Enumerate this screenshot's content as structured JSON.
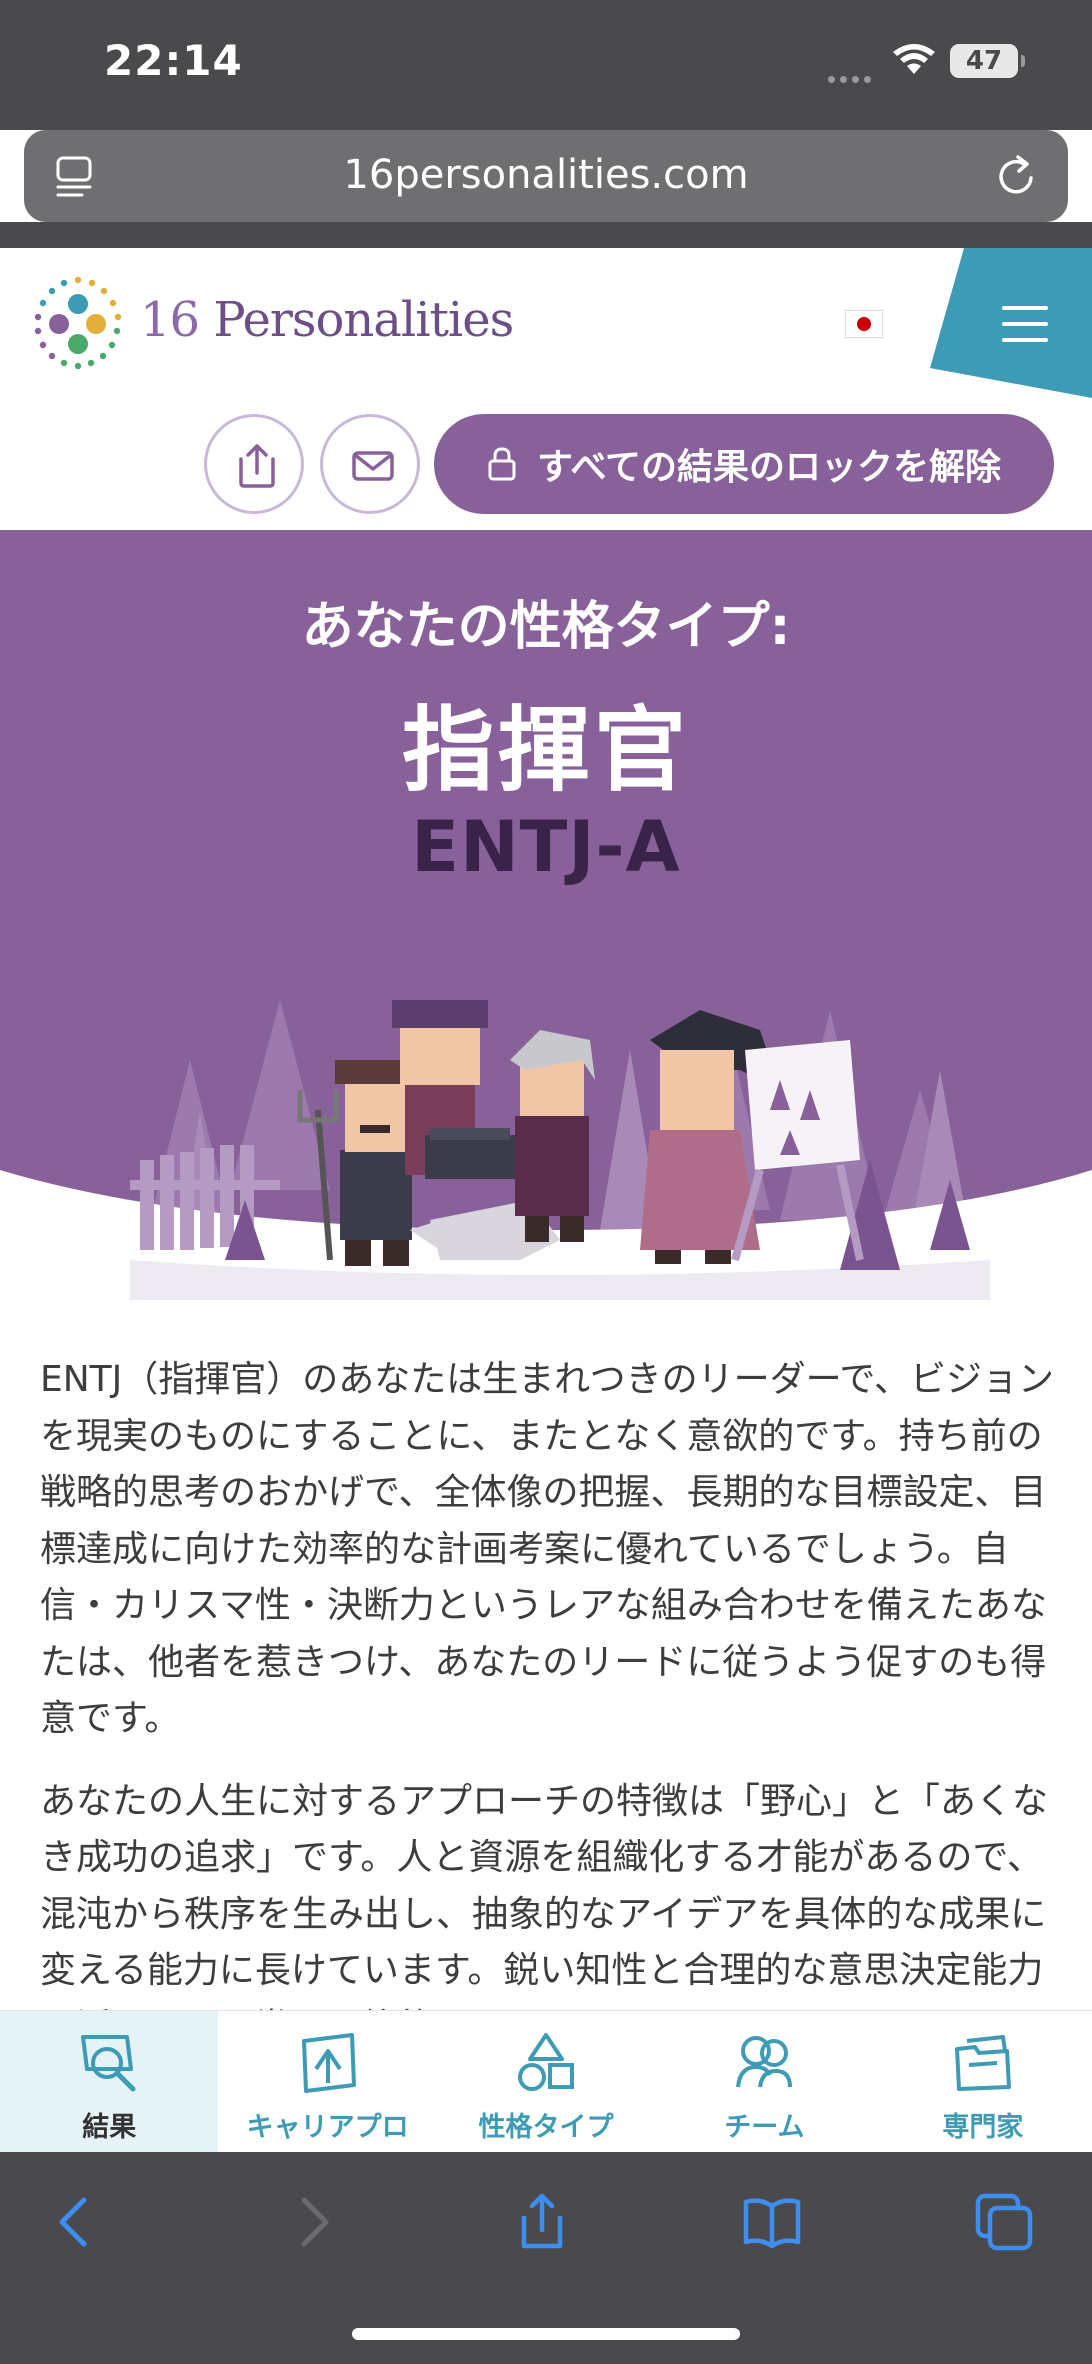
{
  "status_bar": {
    "time": "22:14",
    "battery": "47"
  },
  "browser": {
    "url": "16personalities.com"
  },
  "site": {
    "logo_num": "16",
    "logo_word": "Personalities",
    "unlock_label": "すべての結果のロックを解除"
  },
  "hero": {
    "subtitle": "あなたの性格タイプ:",
    "title": "指揮官",
    "code": "ENTJ-A",
    "colors": {
      "background": "#88619a",
      "code": "#3a2348"
    }
  },
  "article": {
    "paragraphs": [
      "ENTJ（指揮官）のあなたは生まれつきのリーダーで、ビジョンを現実のものにすることに、またとなく意欲的です。持ち前の戦略的思考のおかげで、全体像の把握、長期的な目標設定、目標達成に向けた効率的な計画考案に優れているでしょう。自信・カリスマ性・決断力というレアな組み合わせを備えたあなたは、他者を惹きつけ、あなたのリードに従うよう促すのも得意です。",
      "あなたの人生に対するアプローチの特徴は「野心」と「あくなき成功の追求」です。人と資源を組織化する才能があるので、混沌から秩序を生み出し、抽象的なアイデアを具体的な成果に変える能力に長けています。鋭い知性と合理的な意思決定能力を活かして、常に最終的な"
    ]
  },
  "bottom_nav": {
    "items": [
      {
        "label": "結果",
        "icon": "results-magnifier-icon",
        "active": true
      },
      {
        "label": "キャリアプロ",
        "icon": "career-icon",
        "active": false
      },
      {
        "label": "性格タイプ",
        "icon": "personality-types-icon",
        "active": false
      },
      {
        "label": "チーム",
        "icon": "team-icon",
        "active": false
      },
      {
        "label": "専門家",
        "icon": "experts-folder-icon",
        "active": false
      }
    ],
    "accent": "#3e9bb5"
  }
}
